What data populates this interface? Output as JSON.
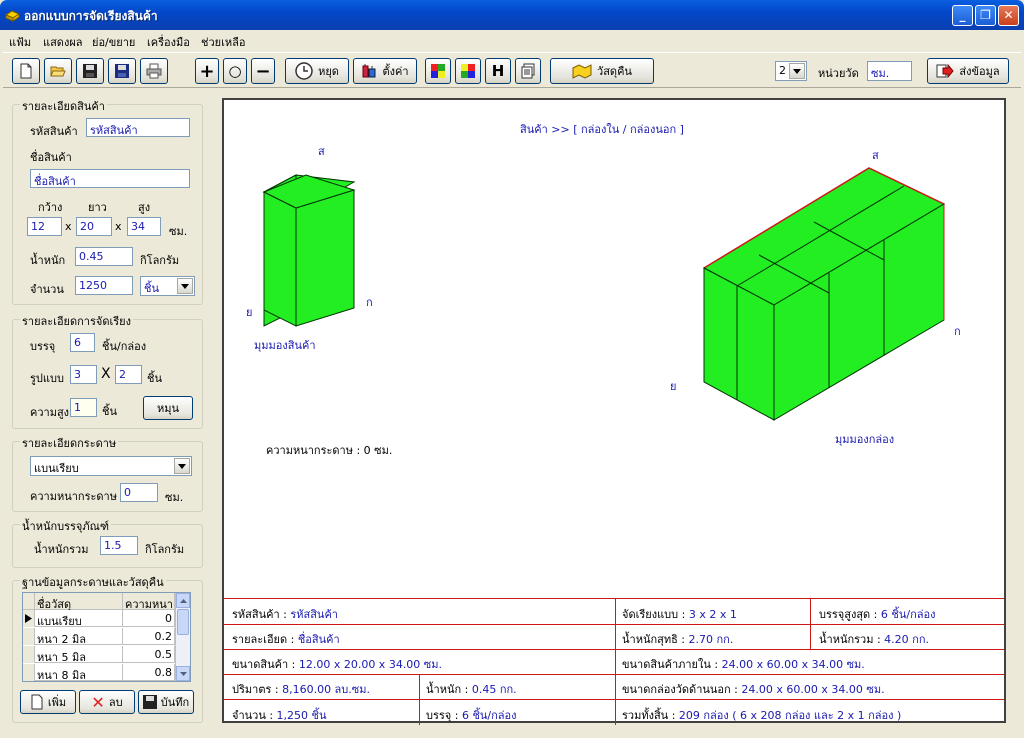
{
  "window": {
    "title": "ออกแบบการจัดเรียงสินค้า"
  },
  "menu": [
    "แฟ้ม",
    "แสดงผล",
    "ย่อ/ขยาย",
    "เครื่องมือ",
    "ช่วยเหลือ"
  ],
  "toolbar": {
    "stop_label": "หยุด",
    "settings_label": "ตั้งค่า",
    "h_label": "H",
    "material_label": "วัสดุคืน",
    "page_value": "2",
    "unit_label": "หน่วยวัด",
    "unit_value": "ซม.",
    "send_label": "ส่งข้อมูล"
  },
  "product": {
    "group_title": "รายละเอียดสินค้า",
    "code_label": "รหัสสินค้า",
    "code_value": "รหัสสินค้า",
    "name_label": "ชื่อสินค้า",
    "name_value": "ชื่อสินค้า",
    "width_label": "กว้าง",
    "length_label": "ยาว",
    "height_label": "สูง",
    "width_value": "12",
    "length_value": "20",
    "height_value": "34",
    "times": "x",
    "dim_unit": "ซม.",
    "weight_label": "น้ำหนัก",
    "weight_value": "0.45",
    "weight_unit": "กิโลกรัม",
    "qty_label": "จำนวน",
    "qty_value": "1250",
    "qty_unit": "ชิ้น"
  },
  "arrangement": {
    "group_title": "รายละเอียดการจัดเรียง",
    "pack_label": "บรรจุ",
    "pack_value": "6",
    "pack_unit": "ชิ้น/กล่อง",
    "pattern_label": "รูปแบบ",
    "pattern_a": "3",
    "pattern_x": "X",
    "pattern_b": "2",
    "pattern_unit": "ชิ้น",
    "height_label": "ความสูง",
    "height_value": "1",
    "height_unit": "ชิ้น",
    "rotate_label": "หมุน"
  },
  "paper": {
    "group_title": "รายละเอียดกระดาษ",
    "type_value": "แบนเรียบ",
    "thickness_label": "ความหนากระดาษ",
    "thickness_value": "0",
    "thickness_unit": "ซม."
  },
  "package_weight": {
    "group_title": "น้ำหนักบรรจุภัณฑ์",
    "total_label": "น้ำหนักรวม",
    "total_value": "1.5",
    "unit": "กิโลกรัม"
  },
  "material_db": {
    "group_title": "ฐานข้อมูลกระดาษและวัสดุคืน",
    "columns": [
      "ชื่อวัสดุ",
      "ความหนา"
    ],
    "rows": [
      {
        "name": "แบนเรียบ",
        "thickness": "0"
      },
      {
        "name": "หนา 2 มิล",
        "thickness": "0.2"
      },
      {
        "name": "หนา 5 มิล",
        "thickness": "0.5"
      },
      {
        "name": "หนา 8 มิล",
        "thickness": "0.8"
      }
    ],
    "add_label": "เพิ่ม",
    "delete_label": "ลบ",
    "save_label": "บันทึก"
  },
  "canvas": {
    "breadcrumb": "สินค้า >> [ กล่องใน / กล่องนอก ]",
    "product_view_label": "มุมมองสินค้า",
    "box_view_label": "มุมมองกล่อง",
    "axis_s": "ส",
    "axis_y": "ย",
    "axis_k": "ก",
    "paper_thickness_text": "ความหนากระดาษ : 0 ซม.",
    "colors": {
      "box_fill": "#22ee22",
      "grid_line": "#d01818",
      "text_blue": "#1a1ab0"
    }
  },
  "summary": {
    "code_k": "รหัสสินค้า : ",
    "code_v": "รหัสสินค้า",
    "arrange_k": "จัดเรียงแบบ : ",
    "arrange_v": "3 x 2 x 1",
    "maxpack_k": "บรรจุสูงสุด : ",
    "maxpack_v": "6 ชิ้น/กล่อง",
    "detail_k": "รายละเอียด : ",
    "detail_v": "ชื่อสินค้า",
    "net_k": "น้ำหนักสุทธิ : ",
    "net_v": "2.70 กก.",
    "gross_k": "น้ำหนักรวม : ",
    "gross_v": "4.20 กก.",
    "size_k": "ขนาดสินค้า : ",
    "size_v": "12.00 x 20.00 x 34.00 ซม.",
    "inner_k": "ขนาดสินค้าภายใน : ",
    "inner_v": "24.00 x 60.00 x 34.00 ซม.",
    "volume_k": "ปริมาตร : ",
    "volume_v": "8,160.00 ลบ.ซม.",
    "weight_k": "น้ำหนัก : ",
    "weight_v": "0.45 กก.",
    "outer_k": "ขนาดกล่องวัดด้านนอก : ",
    "outer_v": "24.00 x 60.00 x 34.00 ซม.",
    "qty_k": "จำนวน : ",
    "qty_v": "1,250 ชิ้น",
    "pack_k": "บรรจุ : ",
    "pack_v": "6 ชิ้น/กล่อง",
    "total_k": "รวมทั้งสิ้น : ",
    "total_v": "209 กล่อง  ( 6 x 208 กล่อง และ 2 x 1 กล่อง )"
  }
}
